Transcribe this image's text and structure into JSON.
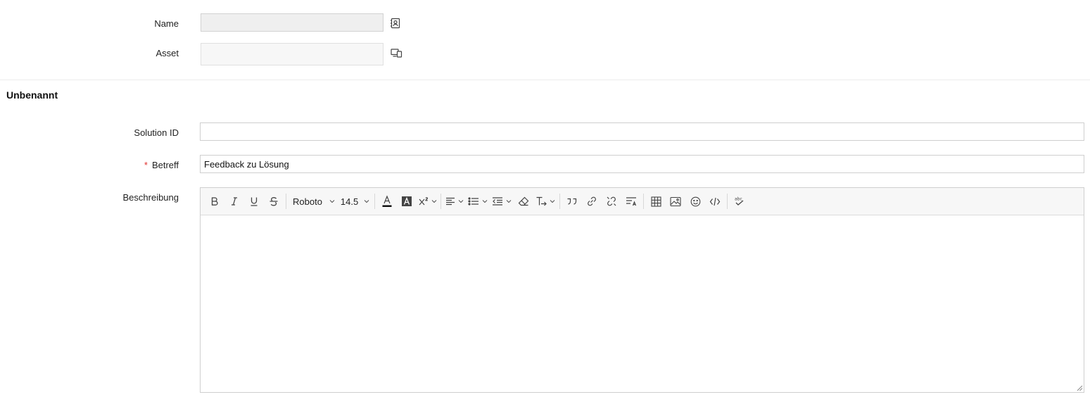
{
  "fields": {
    "name": {
      "label": "Name",
      "value": "",
      "icon": "contact-book-icon"
    },
    "asset": {
      "label": "Asset",
      "value": "",
      "icon": "devices-icon"
    }
  },
  "section": {
    "title": "Unbenannt"
  },
  "form": {
    "solution_id": {
      "label": "Solution ID",
      "value": ""
    },
    "subject": {
      "label": "Betreff",
      "required_mark": "*",
      "value": "Feedback zu Lösung"
    },
    "description": {
      "label": "Beschreibung"
    }
  },
  "editor": {
    "font_family": "Roboto",
    "font_size": "14.5",
    "text_color": "#111111",
    "tools": [
      "bold-icon",
      "italic-icon",
      "underline-icon",
      "strikethrough-icon",
      "font-color-icon",
      "highlight-icon",
      "superscript-icon",
      "align-icon",
      "bullet-list-icon",
      "indent-icon",
      "eraser-icon",
      "text-direction-icon",
      "quote-icon",
      "link-icon",
      "unlink-icon",
      "line-spacing-icon",
      "table-icon",
      "image-icon",
      "emoji-icon",
      "code-icon",
      "spellcheck-icon"
    ]
  },
  "colors": {
    "required": "#e0322f",
    "border": "#cfcfcf"
  }
}
